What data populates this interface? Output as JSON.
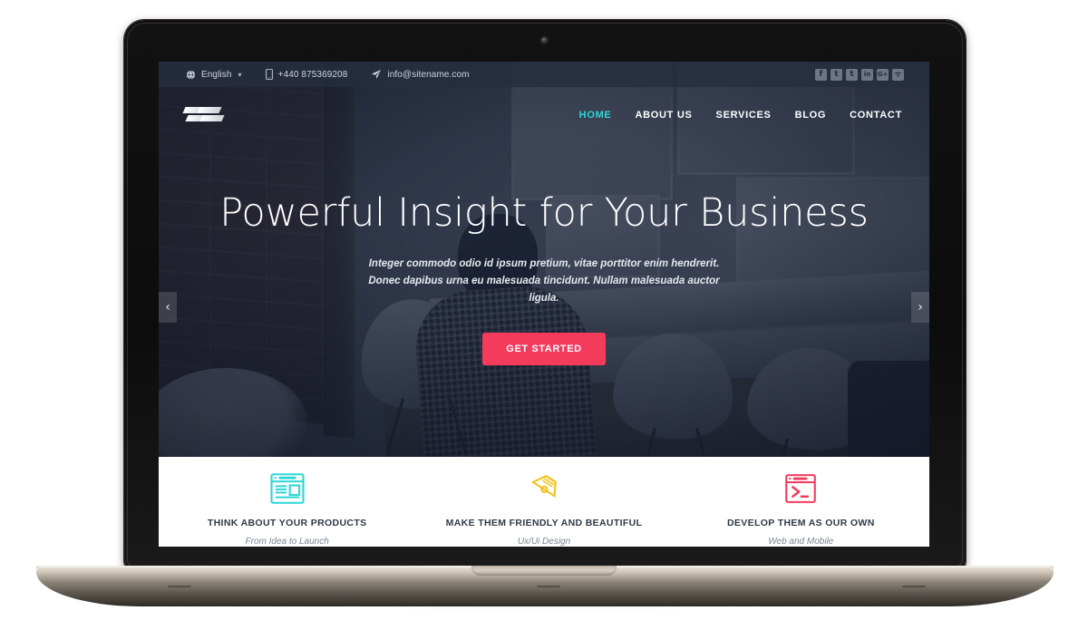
{
  "device": {
    "label": "MacBook"
  },
  "site": {
    "topbar": {
      "language": "English",
      "language_caret": "▾",
      "phone": "+440 875369208",
      "email": "info@sitename.com",
      "social": [
        {
          "name": "facebook",
          "glyph": "f"
        },
        {
          "name": "twitter",
          "glyph": "t"
        },
        {
          "name": "tumblr",
          "glyph": "t"
        },
        {
          "name": "linkedin",
          "glyph": "in"
        },
        {
          "name": "google-plus",
          "glyph": "G+"
        },
        {
          "name": "rss",
          "glyph": "ᯤ"
        }
      ]
    },
    "nav": {
      "logo_name": "site-logo",
      "active_color": "#2fd6d6",
      "links": [
        {
          "label": "HOME",
          "active": true
        },
        {
          "label": "ABOUT US",
          "active": false
        },
        {
          "label": "SERVICES",
          "active": false
        },
        {
          "label": "BLOG",
          "active": false
        },
        {
          "label": "CONTACT",
          "active": false
        }
      ]
    },
    "hero": {
      "title": "Powerful Insight for Your Business",
      "subtitle": "Integer commodo odio id ipsum pretium, vitae porttitor enim hendrerit. Donec dapibus urna eu malesuada tincidunt. Nullam malesuada auctor ligula.",
      "cta_label": "GET STARTED",
      "cta_color": "#f53b5c",
      "prev_arrow": "‹",
      "next_arrow": "›"
    },
    "features": [
      {
        "icon": "browser-layout-icon",
        "icon_color": "#2fd6d6",
        "title": "THINK ABOUT YOUR PRODUCTS",
        "subtitle": "From Idea to Launch"
      },
      {
        "icon": "pen-nib-icon",
        "icon_color": "#f2c21c",
        "title": "MAKE THEM FRIENDLY AND BEAUTIFUL",
        "subtitle": "Ux/Ui Design"
      },
      {
        "icon": "terminal-window-icon",
        "icon_color": "#f53b5c",
        "title": "DEVELOP THEM AS OUR OWN",
        "subtitle": "Web and Mobile"
      }
    ]
  }
}
